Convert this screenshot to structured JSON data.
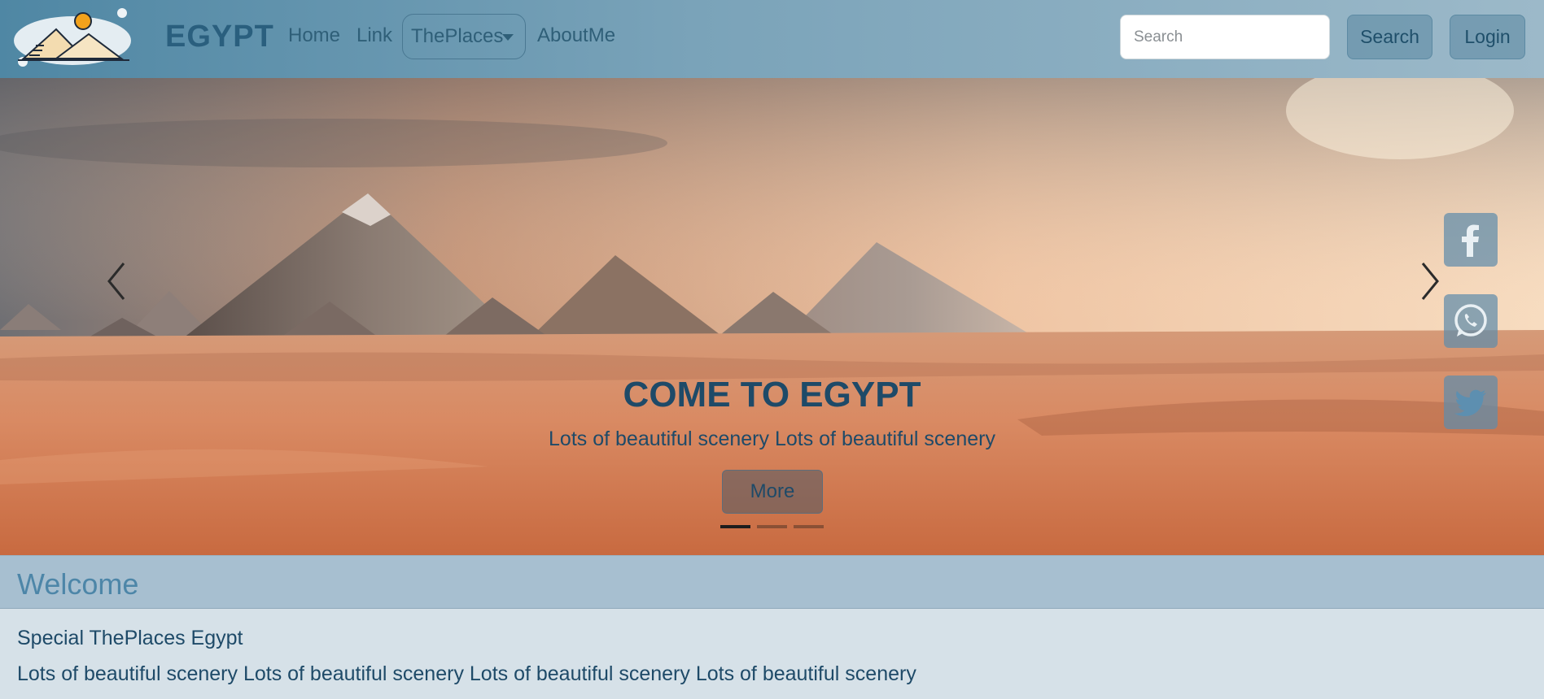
{
  "nav": {
    "brand": "EGYPT",
    "links": [
      "Home",
      "Link"
    ],
    "dropdown_label": "ThePlaces",
    "about_label": "AboutMe",
    "search_placeholder": "Search",
    "search_button": "Search",
    "login_button": "Login"
  },
  "hero": {
    "title": "COME TO EGYPT",
    "subtitle": "Lots of beautiful scenery Lots of beautiful scenery",
    "button": "More",
    "slides_count": 3,
    "active_slide": 1
  },
  "social": [
    "facebook-icon",
    "whatsapp-icon",
    "twitter-icon"
  ],
  "welcome": {
    "title": "Welcome",
    "line1": "Special ThePlaces Egypt",
    "line2": "Lots of beautiful scenery Lots of beautiful scenery Lots of beautiful scenery Lots of beautiful scenery"
  },
  "colors": {
    "accent": "#2a5f7e",
    "text": "#1e4a68",
    "card_header": "#a7bfd0"
  }
}
